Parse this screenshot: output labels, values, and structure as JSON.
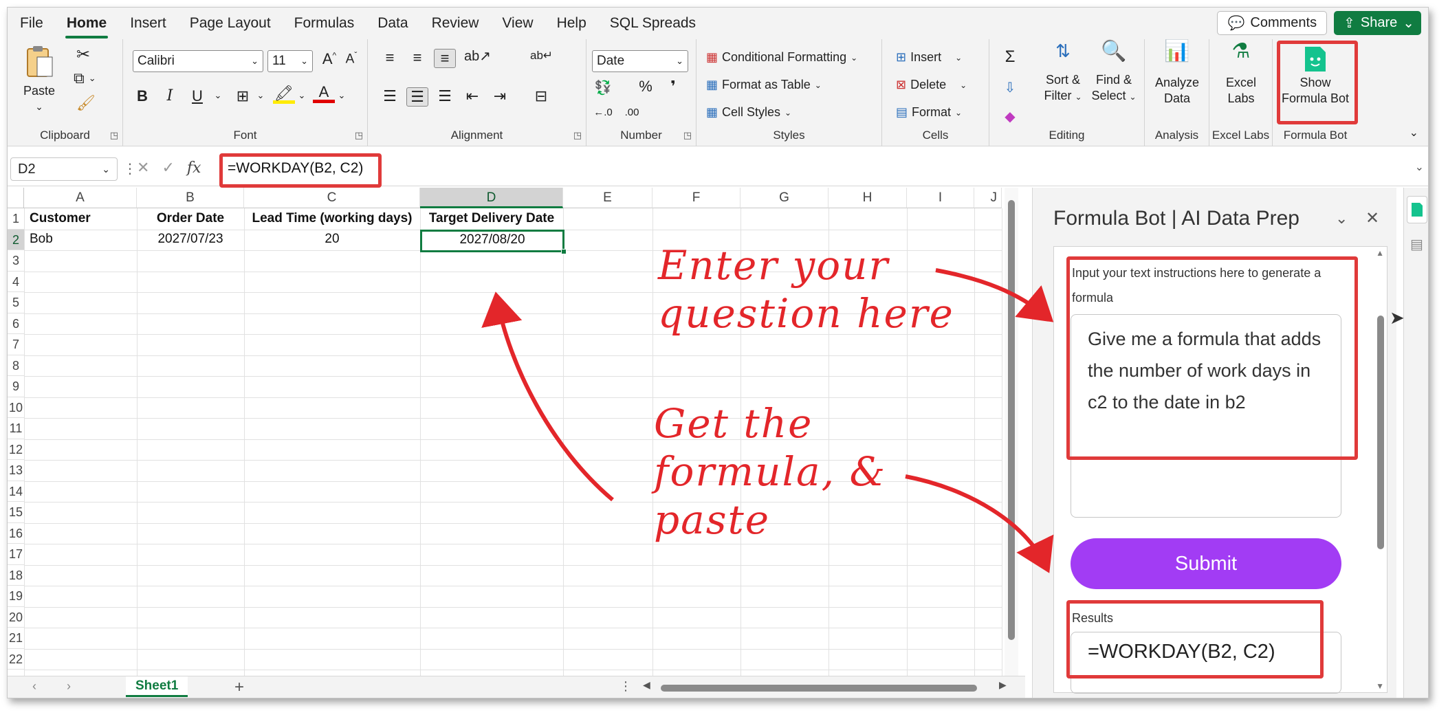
{
  "menu": {
    "items": [
      "File",
      "Home",
      "Insert",
      "Page Layout",
      "Formulas",
      "Data",
      "Review",
      "View",
      "Help",
      "SQL Spreads"
    ],
    "comments": "Comments",
    "share": "Share"
  },
  "ribbon": {
    "clipboard": {
      "paste": "Paste",
      "label": "Clipboard"
    },
    "font": {
      "name": "Calibri",
      "size": "11",
      "label": "Font"
    },
    "alignment": {
      "label": "Alignment"
    },
    "number": {
      "format": "Date",
      "label": "Number"
    },
    "styles": {
      "conditional": "Conditional Formatting",
      "table": "Format as Table",
      "cell": "Cell Styles",
      "label": "Styles"
    },
    "cells": {
      "insert": "Insert",
      "delete": "Delete",
      "format": "Format",
      "label": "Cells"
    },
    "editing": {
      "sort1": "Sort &",
      "sort2": "Filter",
      "find1": "Find &",
      "find2": "Select",
      "label": "Editing"
    },
    "analysis": {
      "l1": "Analyze",
      "l2": "Data",
      "label": "Analysis"
    },
    "excellabs": {
      "l1": "Excel",
      "l2": "Labs",
      "label": "Excel Labs"
    },
    "formulabot": {
      "l1": "Show",
      "l2": "Formula Bot",
      "label": "Formula Bot"
    }
  },
  "formula_bar": {
    "name_box": "D2",
    "formula": "=WORKDAY(B2, C2)"
  },
  "sheet": {
    "columns": [
      "A",
      "B",
      "C",
      "D",
      "E",
      "F",
      "G",
      "H",
      "I",
      "J"
    ],
    "rows": [
      "1",
      "2",
      "3",
      "4",
      "5",
      "6",
      "7",
      "8",
      "9",
      "10",
      "11",
      "12",
      "13",
      "14",
      "15",
      "16",
      "17",
      "18",
      "19",
      "20",
      "21",
      "22"
    ],
    "headers": {
      "a": "Customer",
      "b": "Order Date",
      "c": "Lead Time (working days)",
      "d": "Target Delivery Date"
    },
    "row2": {
      "a": "Bob",
      "b": "2027/07/23",
      "c": "20",
      "d": "2027/08/20"
    },
    "tab": "Sheet1"
  },
  "panel": {
    "title": "Formula Bot | AI Data Prep",
    "input_label": "Input your text instructions here to generate a formula",
    "input_value": "Give me a formula that adds the number of work days in c2 to the date in b2",
    "submit": "Submit",
    "results_label": "Results",
    "result": "=WORKDAY(B2, C2)"
  },
  "annotations": {
    "enter1": "Enter your",
    "enter2": "question here",
    "get1": "Get the",
    "get2": "formula, &",
    "get3": "paste"
  },
  "colors": {
    "excel_green": "#107c41",
    "highlight_red": "#e03a3a",
    "submit_purple": "#a23cf4",
    "annotation_red": "#e3262a"
  }
}
